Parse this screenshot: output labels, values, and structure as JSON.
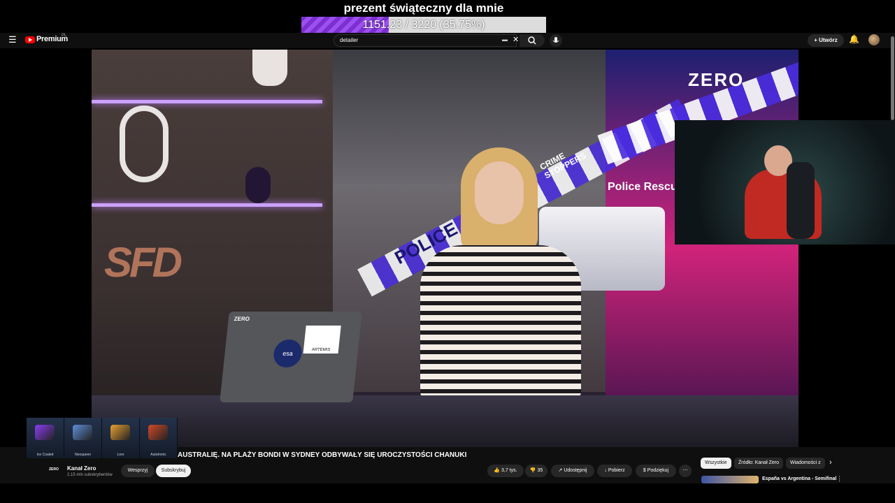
{
  "overlay": {
    "goal_title": "prezent świąteczny dla mnie",
    "goal_text": "1151.23 / 3220 (35.75%)",
    "goal_fraction": 0.3575
  },
  "header": {
    "logo_text": "Premium",
    "logo_sup": "PL",
    "search_value": "detailer",
    "create_label": "Utwórz"
  },
  "video": {
    "studio_logo": "SFD",
    "brand_logo": "ZERO",
    "tape_text": "POLICE",
    "sign_text": "Police Rescue",
    "crime_text": "CRIME STOPPERS",
    "laptop_sticker_1": "ZERO",
    "laptop_sticker_2": "ARTEMIS",
    "laptop_sticker_3": "esa"
  },
  "ticker": {
    "text": "AUSTRALIĘ. NA PLAŻY BONDI W SYDNEY ODBYWAŁY SIĘ UROCZYSTOŚCI CHANUKI"
  },
  "cases": [
    {
      "label": "Ice Coaled",
      "color": "#8a3df0"
    },
    {
      "label": "Neoqueen",
      "color": "#5e8fd8"
    },
    {
      "label": "Lore",
      "color": "#e7a032"
    },
    {
      "label": "Autotronic",
      "color": "#d04a2a"
    }
  ],
  "channel": {
    "avatar_label": "ZERO",
    "name": "Kanał Zero",
    "subs": "2,15 mln subskrybentów",
    "support_label": "Wesprzyj",
    "subscribe_label": "Subskrybuj",
    "likes": "3,7 tys.",
    "dislikes": "35",
    "share_label": "Udostępnij",
    "download_label": "Pobierz",
    "thanks_label": "Podziękuj"
  },
  "chips": [
    "Wszystkie",
    "Źródło: Kanał Zero",
    "Wiadomości z"
  ],
  "recommended": {
    "title": "España vs Argentina - Semifinal"
  }
}
